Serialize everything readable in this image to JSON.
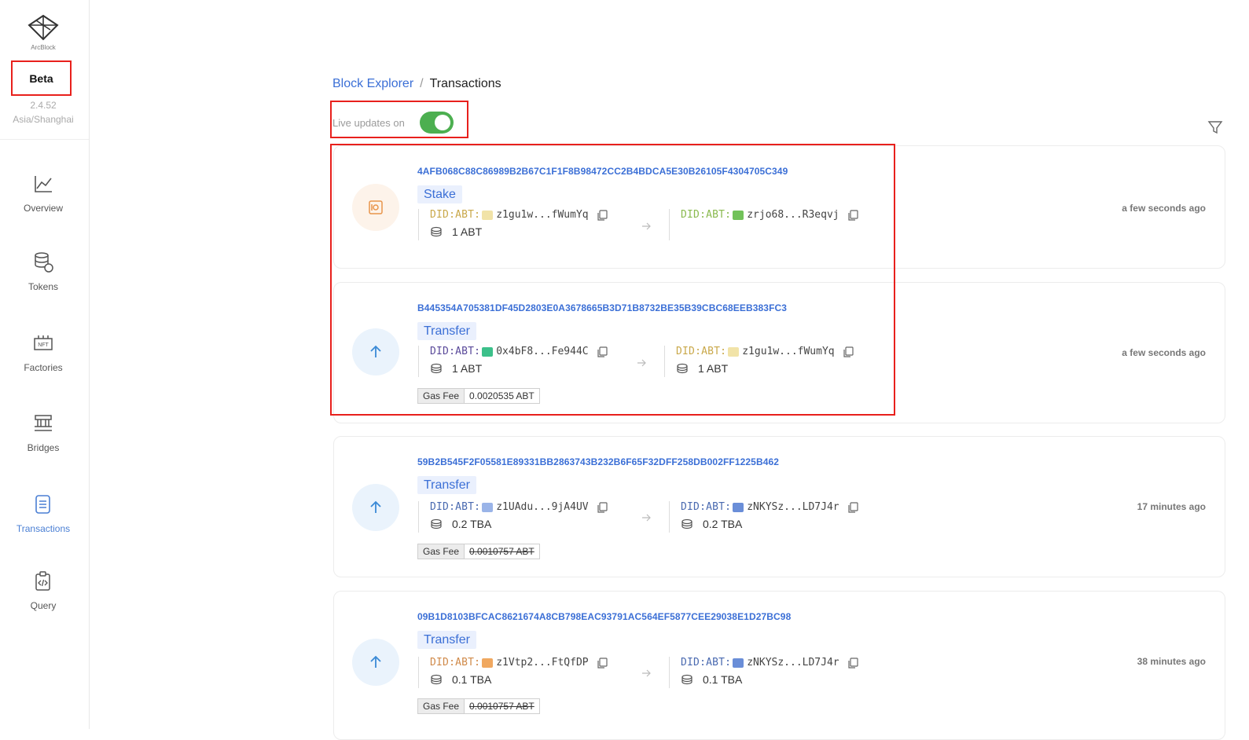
{
  "sidebar": {
    "brand": "ArcBlock",
    "badge": "Beta",
    "version": "2.4.52",
    "timezone": "Asia/Shanghai",
    "nav": [
      {
        "label": "Overview",
        "icon": "chart-line-icon",
        "active": false
      },
      {
        "label": "Tokens",
        "icon": "database-icon",
        "active": false
      },
      {
        "label": "Factories",
        "icon": "nft-icon",
        "active": false
      },
      {
        "label": "Bridges",
        "icon": "bridge-icon",
        "active": false
      },
      {
        "label": "Transactions",
        "icon": "document-icon",
        "active": true
      },
      {
        "label": "Query",
        "icon": "clipboard-code-icon",
        "active": false
      }
    ]
  },
  "breadcrumb": {
    "root": "Block Explorer",
    "separator": "/",
    "current": "Transactions"
  },
  "live_updates": {
    "label": "Live updates on",
    "enabled": true
  },
  "colors": {
    "accent": "#3b6fd6",
    "toggle_on": "#4caf50",
    "highlight": "#e8201c"
  },
  "transactions": [
    {
      "hash": "4AFB068C88C86989B2B67C1F1F8B98472CC2B4BDCA5E30B26105F4304705C349",
      "type": "Stake",
      "icon": "safe-icon",
      "from": {
        "prefix": "DID:ABT:",
        "address": "z1gu1w...fWumYq",
        "amount": "1 ABT"
      },
      "to": {
        "prefix": "DID:ABT:",
        "address": "zrjo68...R3eqvj",
        "amount": ""
      },
      "gas_label": "",
      "gas_value": "",
      "time": "a few seconds ago"
    },
    {
      "hash": "B445354A705381DF45D2803E0A3678665B3D71B8732BE35B39CBC68EEB383FC3",
      "type": "Transfer",
      "icon": "arrow-up-icon",
      "from": {
        "prefix": "DID:ABT:",
        "address": "0x4bF8...Fe944C",
        "amount": "1 ABT"
      },
      "to": {
        "prefix": "DID:ABT:",
        "address": "z1gu1w...fWumYq",
        "amount": "1 ABT"
      },
      "gas_label": "Gas Fee",
      "gas_value": "0.0020535 ABT",
      "time": "a few seconds ago"
    },
    {
      "hash": "59B2B545F2F05581E89331BB2863743B232B6F65F32DFF258DB002FF1225B462",
      "type": "Transfer",
      "icon": "arrow-up-icon",
      "from": {
        "prefix": "DID:ABT:",
        "address": "z1UAdu...9jA4UV",
        "amount": "0.2 TBA"
      },
      "to": {
        "prefix": "DID:ABT:",
        "address": "zNKYSz...LD7J4r",
        "amount": "0.2 TBA"
      },
      "gas_label": "Gas Fee",
      "gas_value": "0.0010757 ABT",
      "time": "17 minutes ago"
    },
    {
      "hash": "09B1D8103BFCAC8621674A8CB798EAC93791AC564EF5877CEE29038E1D27BC98",
      "type": "Transfer",
      "icon": "arrow-up-icon",
      "from": {
        "prefix": "DID:ABT:",
        "address": "z1Vtp2...FtQfDP",
        "amount": "0.1 TBA"
      },
      "to": {
        "prefix": "DID:ABT:",
        "address": "zNKYSz...LD7J4r",
        "amount": "0.1 TBA"
      },
      "gas_label": "Gas Fee",
      "gas_value": "0.0010757 ABT",
      "time": "38 minutes ago"
    }
  ]
}
